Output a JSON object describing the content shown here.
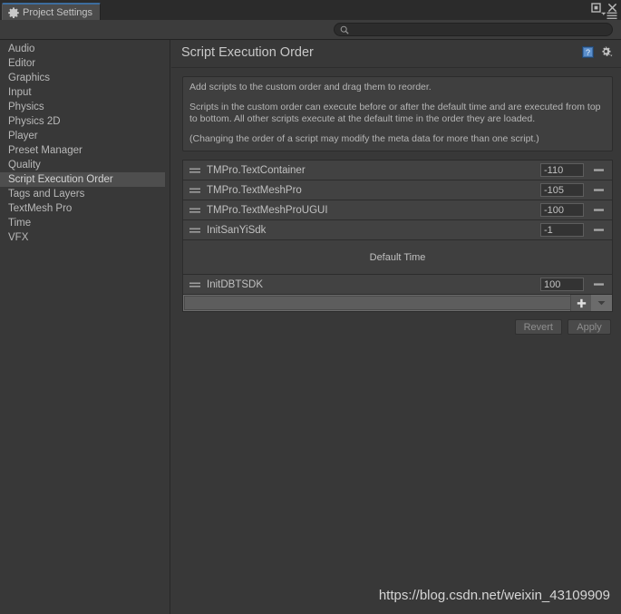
{
  "window": {
    "tab_label": "Project Settings",
    "tab_icon": "gear-icon",
    "maximize_icon": "maximize-icon",
    "close_icon": "close-icon",
    "menu_icon": "hamburger-menu-icon"
  },
  "search": {
    "icon": "search-icon",
    "value": "",
    "placeholder": ""
  },
  "sidebar": {
    "items": [
      {
        "label": "Audio",
        "selected": false
      },
      {
        "label": "Editor",
        "selected": false
      },
      {
        "label": "Graphics",
        "selected": false
      },
      {
        "label": "Input",
        "selected": false
      },
      {
        "label": "Physics",
        "selected": false
      },
      {
        "label": "Physics 2D",
        "selected": false
      },
      {
        "label": "Player",
        "selected": false
      },
      {
        "label": "Preset Manager",
        "selected": false
      },
      {
        "label": "Quality",
        "selected": false
      },
      {
        "label": "Script Execution Order",
        "selected": true
      },
      {
        "label": "Tags and Layers",
        "selected": false
      },
      {
        "label": "TextMesh Pro",
        "selected": false
      },
      {
        "label": "Time",
        "selected": false
      },
      {
        "label": "VFX",
        "selected": false
      }
    ]
  },
  "main": {
    "title": "Script Execution Order",
    "help_icon": "help-book-icon",
    "settings_icon": "gear-dropdown-icon",
    "help_text": {
      "line1": "Add scripts to the custom order and drag them to reorder.",
      "line2": "Scripts in the custom order can execute before or after the default time and are executed from top to bottom. All other scripts execute at the default time in the order they are loaded.",
      "line3": "(Changing the order of a script may modify the meta data for more than one script.)"
    },
    "rows_before_default": [
      {
        "name": "TMPro.TextContainer",
        "order": "-110",
        "handle_icon": "drag-handle-icon",
        "remove_icon": "minus-icon"
      },
      {
        "name": "TMPro.TextMeshPro",
        "order": "-105",
        "handle_icon": "drag-handle-icon",
        "remove_icon": "minus-icon"
      },
      {
        "name": "TMPro.TextMeshProUGUI",
        "order": "-100",
        "handle_icon": "drag-handle-icon",
        "remove_icon": "minus-icon"
      },
      {
        "name": "InitSanYiSdk",
        "order": "-1",
        "handle_icon": "drag-handle-icon",
        "remove_icon": "minus-icon"
      }
    ],
    "default_time_label": "Default Time",
    "rows_after_default": [
      {
        "name": "InitDBTSDK",
        "order": "100",
        "handle_icon": "drag-handle-icon",
        "remove_icon": "minus-icon"
      }
    ],
    "add_bar": {
      "field_value": "",
      "add_icon": "plus-icon",
      "caret_icon": "chevron-down-icon"
    },
    "revert_label": "Revert",
    "apply_label": "Apply"
  },
  "watermark": {
    "text": "https://blog.csdn.net/weixin_43109909"
  },
  "colors": {
    "background": "#383838",
    "row": "#424242",
    "selection": "#4e4e4e",
    "tab_accent": "#3d6d9e",
    "text": "#c0c0c0",
    "disabled_text": "#8e8e8e"
  }
}
